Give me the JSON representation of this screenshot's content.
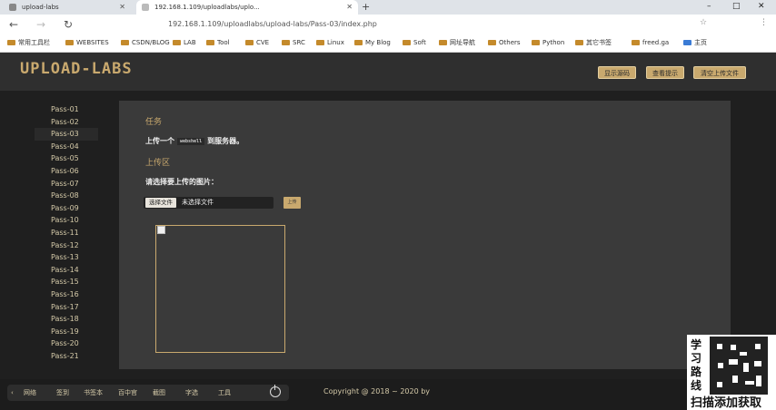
{
  "browser": {
    "tabs": [
      {
        "label": "upload-labs",
        "active": false
      },
      {
        "label": "192.168.1.109/uploadlabs/uplo...",
        "active": true
      }
    ],
    "new_tab": "+",
    "window_controls": [
      "–",
      "□",
      "✕"
    ],
    "nav": {
      "back": "←",
      "forward": "→",
      "reload": "↻"
    },
    "url": "192.168.1.109/uploadlabs/upload-labs/Pass-03/index.php",
    "bookmarks": [
      "常用工具栏",
      "WEBSITES",
      "CSDN/BLOG",
      "LAB",
      "Tool",
      "CVE",
      "SRC",
      "Linux",
      "My Blog",
      "Soft",
      "网址导航",
      "Others",
      "Python",
      "其它书签",
      "freed.ga",
      "主页"
    ]
  },
  "header": {
    "logo": "UPLOAD-LABS",
    "buttons": [
      "显示源码",
      "查看提示",
      "清空上传文件"
    ]
  },
  "sidebar": {
    "items": [
      "Pass-01",
      "Pass-02",
      "Pass-03",
      "Pass-04",
      "Pass-05",
      "Pass-06",
      "Pass-07",
      "Pass-08",
      "Pass-09",
      "Pass-10",
      "Pass-11",
      "Pass-12",
      "Pass-13",
      "Pass-14",
      "Pass-15",
      "Pass-16",
      "Pass-17",
      "Pass-18",
      "Pass-19",
      "Pass-20",
      "Pass-21"
    ],
    "active_index": 2
  },
  "main": {
    "task_title": "任务",
    "task_prefix": "上传一个",
    "task_code": "webshell",
    "task_suffix": "到服务器。",
    "upload_title": "上传区",
    "prompt": "请选择要上传的图片：",
    "choose_label": "选择文件",
    "no_file_label": "未选择文件",
    "upload_button": "上传"
  },
  "footer": {
    "tools": [
      "网络",
      "签到",
      "书签本",
      "百中官",
      "截图",
      "字选",
      "工具"
    ],
    "copyright": "Copyright @ 2018 ~ 2020 by"
  },
  "promo": {
    "vertical": "学习路线",
    "bottom": "扫描添加获取"
  },
  "colors": {
    "accent": "#c9a96e",
    "panel": "#3a3a3a",
    "header": "#2f2f2f"
  }
}
